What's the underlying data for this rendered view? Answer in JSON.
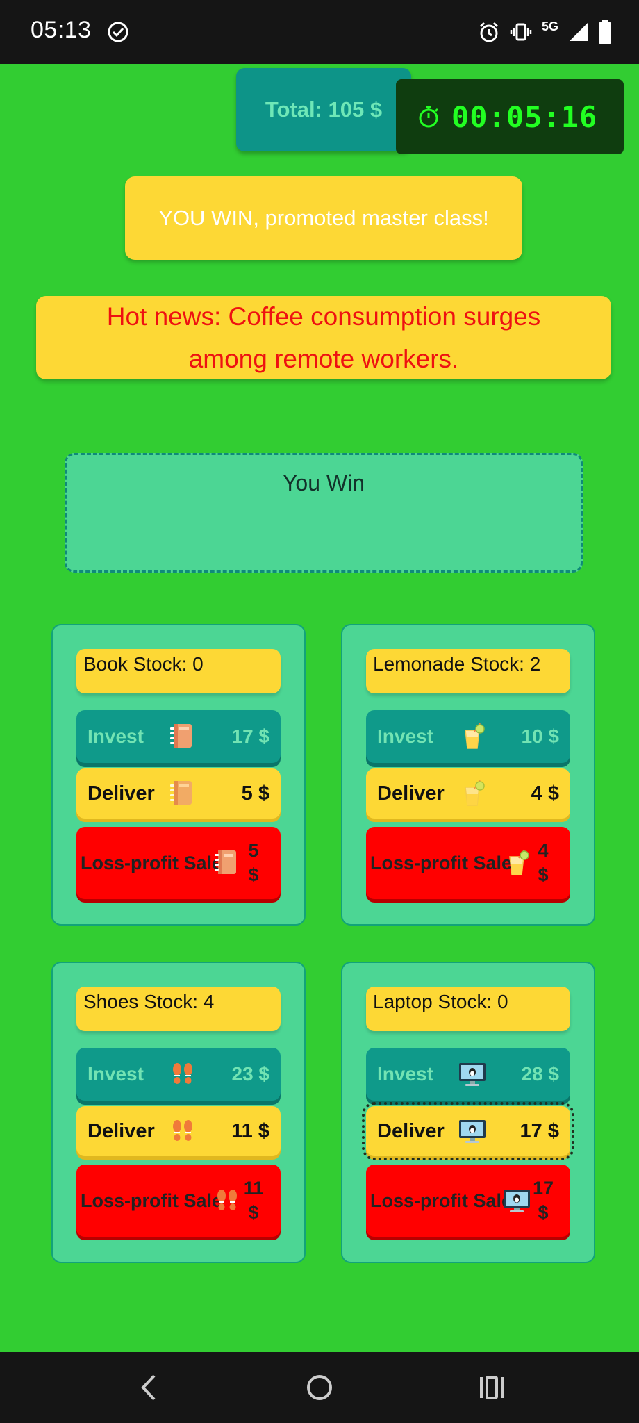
{
  "status_bar": {
    "time": "05:13",
    "network": "5G",
    "icons": [
      "check-circle-icon",
      "alarm-icon",
      "vibrate-icon",
      "signal-icon",
      "battery-icon"
    ]
  },
  "header": {
    "total": "Total: 105 $",
    "timer": "00:05:16",
    "timer_icon": "stopwatch-icon"
  },
  "banner": "YOU WIN, promoted master class!",
  "news": "Hot news: Coffee consumption surges among remote workers.",
  "result": "You Win",
  "products": [
    {
      "stock": "Book Stock: 0",
      "icon": "book-icon",
      "invest": {
        "label": "Invest",
        "amount": "17 $"
      },
      "deliver": {
        "label": "Deliver",
        "amount": "5 $"
      },
      "sale": {
        "label": "Loss-profit Sale",
        "amount": "5 $"
      }
    },
    {
      "stock": "Lemonade Stock: 2",
      "icon": "lemonade-icon",
      "invest": {
        "label": "Invest",
        "amount": "10 $"
      },
      "deliver": {
        "label": "Deliver",
        "amount": "4 $"
      },
      "sale": {
        "label": "Loss-profit Sale",
        "amount": "4 $"
      }
    },
    {
      "stock": "Shoes Stock: 4",
      "icon": "footprints-icon",
      "invest": {
        "label": "Invest",
        "amount": "23 $"
      },
      "deliver": {
        "label": "Deliver",
        "amount": "11 $"
      },
      "sale": {
        "label": "Loss-profit Sale",
        "amount": "11 $"
      }
    },
    {
      "stock": "Laptop Stock: 0",
      "icon": "computer-icon",
      "invest": {
        "label": "Invest",
        "amount": "28 $"
      },
      "deliver": {
        "label": "Deliver",
        "amount": "17 $"
      },
      "sale": {
        "label": "Loss-profit Sale",
        "amount": "17 $"
      }
    }
  ],
  "colors": {
    "background": "#32cd32",
    "card": "#4cd694",
    "yellow": "#fdd835",
    "teal": "#0f9a8a",
    "red": "#ff0000",
    "news_text": "#ee1111",
    "timer_text": "#22ff22"
  },
  "nav": {
    "icons": [
      "back-icon",
      "home-icon",
      "recents-icon"
    ]
  }
}
